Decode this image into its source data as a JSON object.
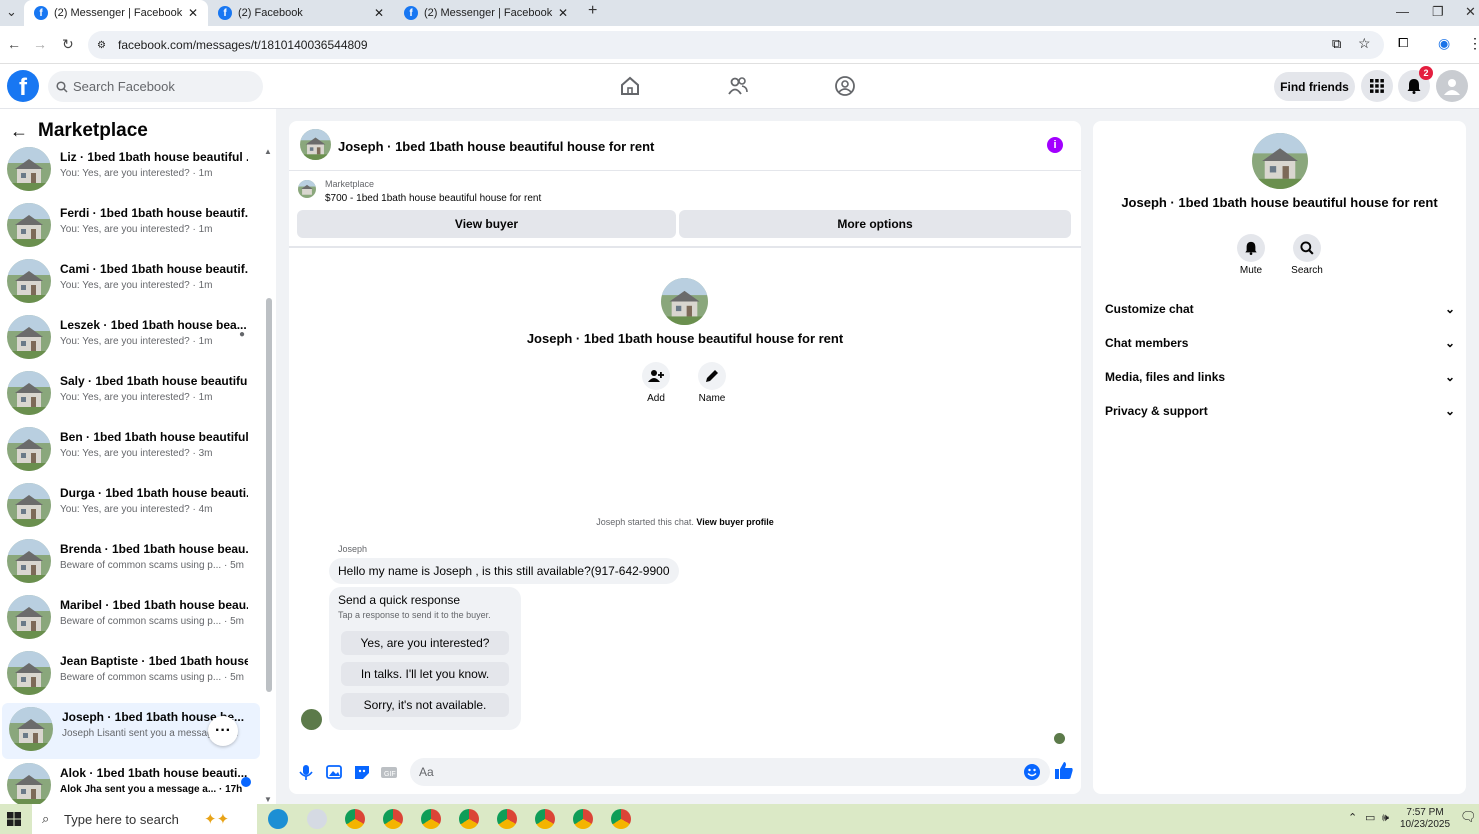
{
  "browser": {
    "tabs": [
      {
        "title": "(2) Messenger | Facebook"
      },
      {
        "title": "(2) Facebook"
      },
      {
        "title": "(2) Messenger | Facebook"
      }
    ],
    "url": "facebook.com/messages/t/1810140036544809"
  },
  "fb": {
    "search_placeholder": "Search Facebook",
    "find_friends": "Find friends",
    "notif_count": "2"
  },
  "sidebar": {
    "title": "Marketplace",
    "conversations": [
      {
        "name": "Liz · 1bed 1bath house beautiful ...",
        "preview": "You: Yes, are you interested? · 1m"
      },
      {
        "name": "Ferdi · 1bed 1bath house beautif...",
        "preview": "You: Yes, are you interested? · 1m"
      },
      {
        "name": "Cami · 1bed 1bath house beautif...",
        "preview": "You: Yes, are you interested? · 1m"
      },
      {
        "name": "Leszek · 1bed 1bath house bea...",
        "preview": "You: Yes, are you interested? · 1m"
      },
      {
        "name": "Saly · 1bed 1bath house beautifu...",
        "preview": "You: Yes, are you interested? · 1m"
      },
      {
        "name": "Ben · 1bed 1bath house beautiful...",
        "preview": "You: Yes, are you interested? · 3m"
      },
      {
        "name": "Durga · 1bed 1bath house beauti...",
        "preview": "You: Yes, are you interested? · 4m"
      },
      {
        "name": "Brenda · 1bed 1bath house beau...",
        "preview": "Beware of common scams using p... · 5m"
      },
      {
        "name": "Maribel · 1bed 1bath house beau...",
        "preview": "Beware of common scams using p... · 5m"
      },
      {
        "name": "Jean Baptiste · 1bed 1bath house...",
        "preview": "Beware of common scams using p... · 5m"
      },
      {
        "name": "Joseph · 1bed 1bath house be...",
        "preview": "Joseph Lisanti sent you a message · 4h"
      },
      {
        "name": "Alok · 1bed 1bath house beauti...",
        "preview": "Alok Jha sent you a message a... · 17h"
      }
    ]
  },
  "chat": {
    "title": "Joseph · 1bed 1bath house beautiful house for rent",
    "marketplace_label": "Marketplace",
    "listing": "$700 - 1bed 1bath house beautiful house for rent",
    "view_buyer": "View buyer",
    "more_options": "More options",
    "profile_name": "Joseph · 1bed 1bath house beautiful house for rent",
    "add_label": "Add",
    "name_label": "Name",
    "started_text": "Joseph started this chat.",
    "view_profile": "View buyer profile",
    "sender": "Joseph",
    "message": "Hello my name is Joseph , is this still available?(917-642-9900",
    "quick_title": "Send a quick response",
    "quick_sub": "Tap a response to send it to the buyer.",
    "quick_replies": [
      "Yes, are you interested?",
      "In talks. I'll let you know.",
      "Sorry, it's not available."
    ],
    "compose_placeholder": "Aa"
  },
  "details": {
    "name": "Joseph · 1bed 1bath house beautiful house for rent",
    "mute": "Mute",
    "search": "Search",
    "sections": [
      "Customize chat",
      "Chat members",
      "Media, files and links",
      "Privacy & support"
    ]
  },
  "taskbar": {
    "search_placeholder": "Type here to search",
    "time": "7:57 PM",
    "date": "10/23/2025"
  },
  "colors": {
    "fb_blue": "#1877f2",
    "messenger_blue": "#0866ff",
    "info_purple": "#a200ff"
  }
}
